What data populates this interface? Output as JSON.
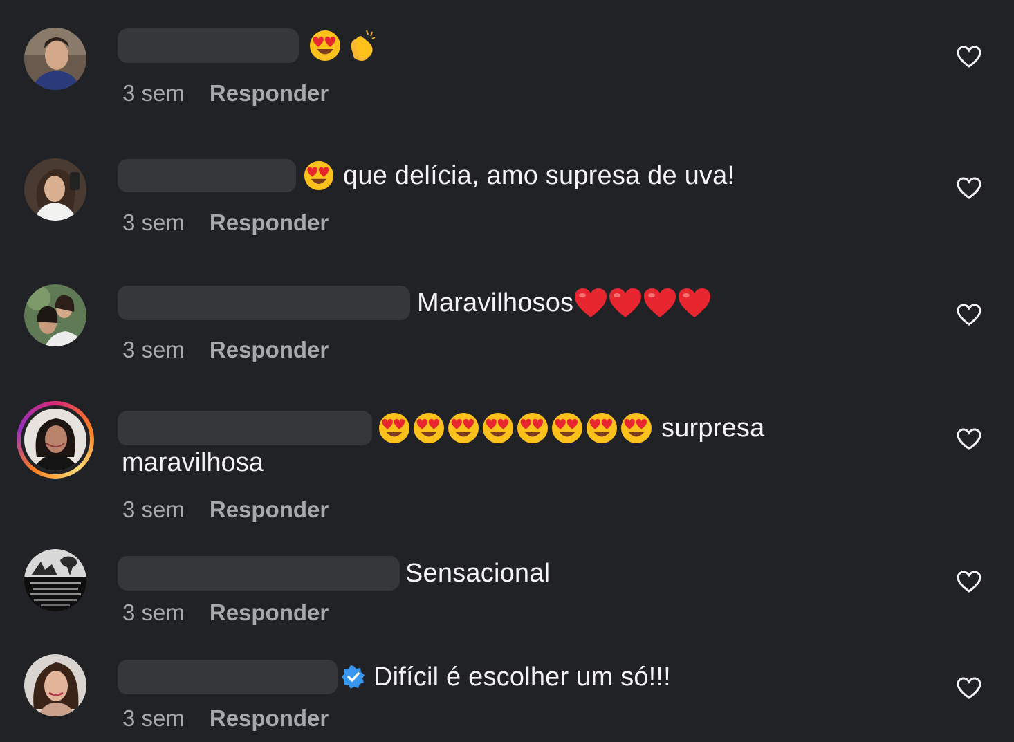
{
  "comments": [
    {
      "avatar_icon": "user-avatar-man",
      "text": "",
      "emojis": [
        "heart-eyes-emoji",
        "clapping-hands-emoji"
      ],
      "timestamp": "3 sem",
      "reply_label": "Responder"
    },
    {
      "avatar_icon": "user-avatar-woman",
      "text": "que delícia, amo supresa de uva!",
      "emojis": [
        "heart-eyes-emoji"
      ],
      "timestamp": "3 sem",
      "reply_label": "Responder"
    },
    {
      "avatar_icon": "user-avatar-group",
      "text": "Maravilhosos",
      "emojis": [
        "red-heart-emoji",
        "red-heart-emoji",
        "red-heart-emoji",
        "red-heart-emoji"
      ],
      "timestamp": "3 sem",
      "reply_label": "Responder"
    },
    {
      "avatar_icon": "user-avatar-story-ring",
      "text": "surpresa",
      "text_line2": "maravilhosa",
      "emojis": [
        "heart-eyes-emoji",
        "heart-eyes-emoji",
        "heart-eyes-emoji",
        "heart-eyes-emoji",
        "heart-eyes-emoji",
        "heart-eyes-emoji",
        "heart-eyes-emoji",
        "heart-eyes-emoji"
      ],
      "timestamp": "3 sem",
      "reply_label": "Responder"
    },
    {
      "avatar_icon": "user-avatar-quote",
      "text": "Sensacional",
      "emojis": [],
      "timestamp": "3 sem",
      "reply_label": "Responder"
    },
    {
      "avatar_icon": "user-avatar-woman-verified",
      "text": "Difícil é escolher um só!!!",
      "verified": true,
      "emojis": [],
      "timestamp": "3 sem",
      "reply_label": "Responder"
    }
  ],
  "colors": {
    "background": "#212226",
    "text": "#f4f4f5",
    "meta": "#a8a9ad",
    "redacted": "#36373b",
    "verified": "#3897f0",
    "heart_red": "#e8262f",
    "emoji_yellow": "#fcc21b"
  },
  "icons": {
    "like": "heart-outline-icon",
    "verified": "verified-badge-icon"
  }
}
